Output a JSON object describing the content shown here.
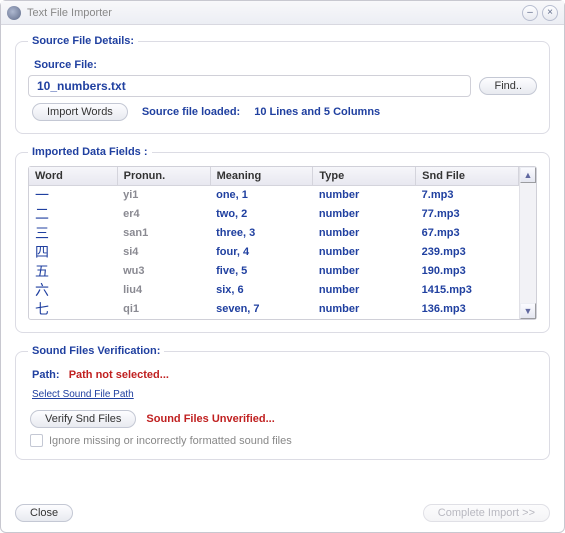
{
  "window": {
    "title": "Text File Importer"
  },
  "source": {
    "legend": "Source File Details:",
    "fileLabel": "Source File:",
    "fileValue": "10_numbers.txt",
    "findLabel": "Find..",
    "importLabel": "Import Words",
    "statusPrefix": "Source file loaded:",
    "statusDetail": "10 Lines and 5 Columns"
  },
  "imported": {
    "legend": "Imported Data Fields :",
    "headers": {
      "word": "Word",
      "pronun": "Pronun.",
      "meaning": "Meaning",
      "type": "Type",
      "snd": "Snd File"
    },
    "rows": [
      {
        "word": "一",
        "pronun": "yi1",
        "meaning": "one, 1",
        "type": "number",
        "snd": "7.mp3"
      },
      {
        "word": "二",
        "pronun": "er4",
        "meaning": "two, 2",
        "type": "number",
        "snd": "77.mp3"
      },
      {
        "word": "三",
        "pronun": "san1",
        "meaning": "three, 3",
        "type": "number",
        "snd": "67.mp3"
      },
      {
        "word": "四",
        "pronun": "si4",
        "meaning": "four, 4",
        "type": "number",
        "snd": "239.mp3"
      },
      {
        "word": "五",
        "pronun": "wu3",
        "meaning": "five, 5",
        "type": "number",
        "snd": "190.mp3"
      },
      {
        "word": "六",
        "pronun": "liu4",
        "meaning": "six, 6",
        "type": "number",
        "snd": "1415.mp3"
      },
      {
        "word": "七",
        "pronun": "qi1",
        "meaning": "seven, 7",
        "type": "number",
        "snd": "136.mp3"
      }
    ]
  },
  "verify": {
    "legend": "Sound Files Verification:",
    "pathLabel": "Path:",
    "pathValue": "Path not selected...",
    "selectLink": "Select Sound File Path",
    "verifyButton": "Verify Snd Files",
    "verifyStatus": "Sound Files Unverified...",
    "ignoreLabel": "Ignore missing or incorrectly formatted sound files"
  },
  "footer": {
    "close": "Close",
    "complete": "Complete Import >>"
  }
}
